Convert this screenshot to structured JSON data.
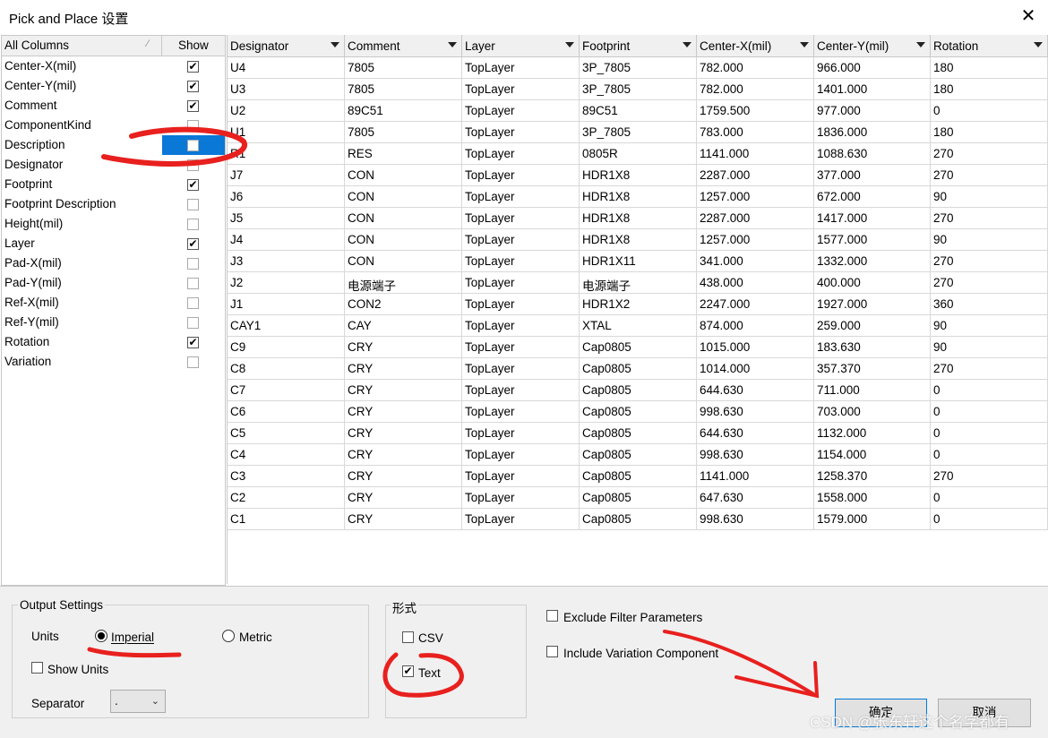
{
  "window": {
    "title": "Pick and Place 设置",
    "close_glyph": "✕"
  },
  "columns_list": {
    "header_name": "All Columns",
    "header_sort_glyph": "⁄",
    "header_show": "Show",
    "items": [
      {
        "label": "Center-X(mil)",
        "checked": true
      },
      {
        "label": "Center-Y(mil)",
        "checked": true
      },
      {
        "label": "Comment",
        "checked": true
      },
      {
        "label": "ComponentKind",
        "checked": false
      },
      {
        "label": "Description",
        "checked": false,
        "selected": true
      },
      {
        "label": "Designator",
        "checked": false
      },
      {
        "label": "Footprint",
        "checked": true
      },
      {
        "label": "Footprint Description",
        "checked": false
      },
      {
        "label": "Height(mil)",
        "checked": false
      },
      {
        "label": "Layer",
        "checked": true
      },
      {
        "label": "Pad-X(mil)",
        "checked": false
      },
      {
        "label": "Pad-Y(mil)",
        "checked": false
      },
      {
        "label": "Ref-X(mil)",
        "checked": false
      },
      {
        "label": "Ref-Y(mil)",
        "checked": false
      },
      {
        "label": "Rotation",
        "checked": true
      },
      {
        "label": "Variation",
        "checked": false
      }
    ]
  },
  "grid": {
    "headers": [
      "Designator",
      "Comment",
      "Layer",
      "Footprint",
      "Center-X(mil)",
      "Center-Y(mil)",
      "Rotation"
    ],
    "rows": [
      [
        "U4",
        "7805",
        "TopLayer",
        "3P_7805",
        "782.000",
        "966.000",
        "180"
      ],
      [
        "U3",
        "7805",
        "TopLayer",
        "3P_7805",
        "782.000",
        "1401.000",
        "180"
      ],
      [
        "U2",
        "89C51",
        "TopLayer",
        "89C51",
        "1759.500",
        "977.000",
        "0"
      ],
      [
        "U1",
        "7805",
        "TopLayer",
        "3P_7805",
        "783.000",
        "1836.000",
        "180"
      ],
      [
        "R1",
        "RES",
        "TopLayer",
        "0805R",
        "1141.000",
        "1088.630",
        "270"
      ],
      [
        "J7",
        "CON",
        "TopLayer",
        "HDR1X8",
        "2287.000",
        "377.000",
        "270"
      ],
      [
        "J6",
        "CON",
        "TopLayer",
        "HDR1X8",
        "1257.000",
        "672.000",
        "90"
      ],
      [
        "J5",
        "CON",
        "TopLayer",
        "HDR1X8",
        "2287.000",
        "1417.000",
        "270"
      ],
      [
        "J4",
        "CON",
        "TopLayer",
        "HDR1X8",
        "1257.000",
        "1577.000",
        "90"
      ],
      [
        "J3",
        "CON",
        "TopLayer",
        "HDR1X11",
        "341.000",
        "1332.000",
        "270"
      ],
      [
        "J2",
        "电源端子",
        "TopLayer",
        "电源端子",
        "438.000",
        "400.000",
        "270"
      ],
      [
        "J1",
        "CON2",
        "TopLayer",
        "HDR1X2",
        "2247.000",
        "1927.000",
        "360"
      ],
      [
        "CAY1",
        "CAY",
        "TopLayer",
        "XTAL",
        "874.000",
        "259.000",
        "90"
      ],
      [
        "C9",
        "CRY",
        "TopLayer",
        "Cap0805",
        "1015.000",
        "183.630",
        "90"
      ],
      [
        "C8",
        "CRY",
        "TopLayer",
        "Cap0805",
        "1014.000",
        "357.370",
        "270"
      ],
      [
        "C7",
        "CRY",
        "TopLayer",
        "Cap0805",
        "644.630",
        "711.000",
        "0"
      ],
      [
        "C6",
        "CRY",
        "TopLayer",
        "Cap0805",
        "998.630",
        "703.000",
        "0"
      ],
      [
        "C5",
        "CRY",
        "TopLayer",
        "Cap0805",
        "644.630",
        "1132.000",
        "0"
      ],
      [
        "C4",
        "CRY",
        "TopLayer",
        "Cap0805",
        "998.630",
        "1154.000",
        "0"
      ],
      [
        "C3",
        "CRY",
        "TopLayer",
        "Cap0805",
        "1141.000",
        "1258.370",
        "270"
      ],
      [
        "C2",
        "CRY",
        "TopLayer",
        "Cap0805",
        "647.630",
        "1558.000",
        "0"
      ],
      [
        "C1",
        "CRY",
        "TopLayer",
        "Cap0805",
        "998.630",
        "1579.000",
        "0"
      ]
    ]
  },
  "output_settings": {
    "group_label": "Output Settings",
    "units_label": "Units",
    "imperial_label": "Imperial",
    "metric_label": "Metric",
    "selected_unit": "Imperial",
    "show_units_label": "Show Units",
    "show_units_checked": false,
    "separator_label": "Separator",
    "separator_value": "."
  },
  "format": {
    "group_label": "形式",
    "csv_label": "CSV",
    "csv_checked": false,
    "text_label": "Text",
    "text_checked": true
  },
  "options": {
    "exclude_filter_label": "Exclude Filter Parameters",
    "exclude_filter_checked": false,
    "include_variation_label": "Include Variation Component",
    "include_variation_checked": false
  },
  "buttons": {
    "ok": "确定",
    "cancel": "取消"
  },
  "watermark": "CSDN @张东轩这个名字都有"
}
